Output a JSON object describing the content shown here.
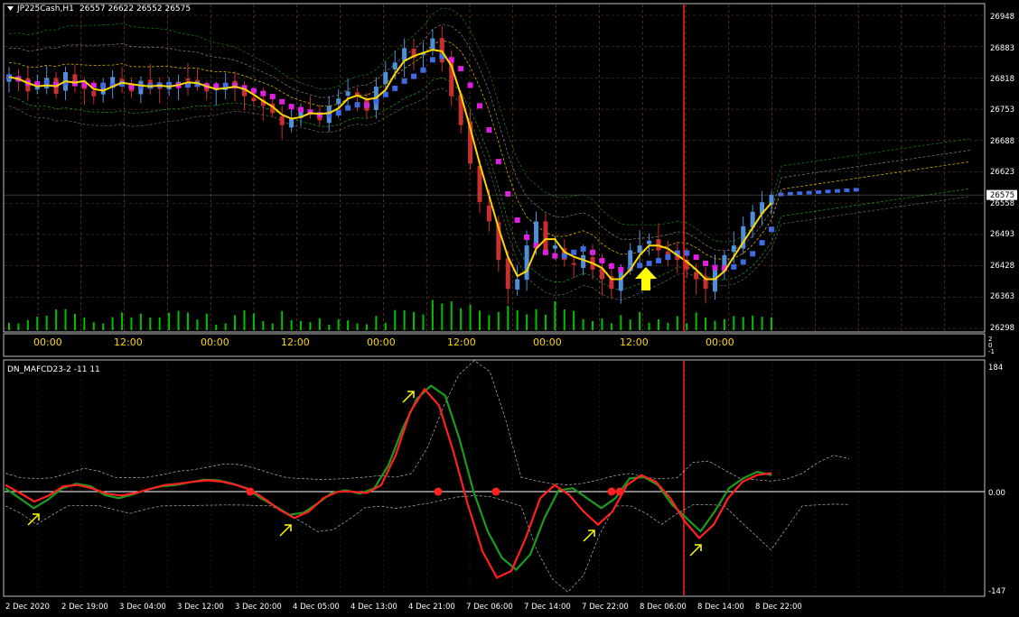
{
  "colors": {
    "background": "#000000",
    "frame": "#c0c0c0",
    "grid": "#c87a30",
    "bull_candle": "#4f8fd8",
    "bear_candle": "#c83030",
    "volume": "#00c000",
    "ma_fast": "#ffd700",
    "ma_bull": "#4169e1",
    "ma_bear": "#e020e0",
    "vline": "#ff2020",
    "arrow": "#ffff00",
    "osc_green": "#1e9a1e",
    "osc_red": "#ff2020",
    "osc_zero": "#ffffff",
    "text": "#ffffff"
  },
  "header": {
    "symbol_title": "JP225Cash,H1",
    "ohlc": "26557 26622 26552 26575",
    "menu_icon": "triangle-down-icon"
  },
  "price_scale": {
    "labels": [
      "26948",
      "26883",
      "26818",
      "26753",
      "26688",
      "26623",
      "26558",
      "26493",
      "26428",
      "26363",
      "26298"
    ],
    "current_price": "26575"
  },
  "time_strip": {
    "labels": [
      "00:00",
      "12:00",
      "00:00",
      "12:00",
      "00:00",
      "12:00",
      "00:00",
      "12:00",
      "00:00"
    ],
    "scale_labels": [
      "2",
      "0",
      "-1"
    ]
  },
  "oscillator": {
    "title": "DN_MAFCD23-2 -11 11",
    "scale_top": "184",
    "scale_zero": "0.00",
    "scale_bottom": "-147"
  },
  "bottom_axis": {
    "labels": [
      "2 Dec 2020",
      "2 Dec 19:00",
      "3 Dec 04:00",
      "3 Dec 12:00",
      "3 Dec 20:00",
      "4 Dec 05:00",
      "4 Dec 13:00",
      "4 Dec 21:00",
      "7 Dec 06:00",
      "7 Dec 14:00",
      "7 Dec 22:00",
      "8 Dec 06:00",
      "8 Dec 14:00",
      "8 Dec 22:00"
    ]
  },
  "chart_data": [
    {
      "type": "candlestick",
      "title": "JP225Cash,H1",
      "ylim": [
        26298,
        26960
      ],
      "price_ticks": [
        26948,
        26883,
        26818,
        26753,
        26688,
        26623,
        26558,
        26493,
        26428,
        26363,
        26298
      ],
      "current_price": 26575,
      "last_bar": {
        "open": 26557,
        "high": 26622,
        "low": 26552,
        "close": 26575
      },
      "close_path": [
        26820,
        26812,
        26790,
        26800,
        26818,
        26785,
        26830,
        26810,
        26795,
        26780,
        26800,
        26820,
        26805,
        26790,
        26812,
        26800,
        26795,
        26805,
        26810,
        26812,
        26800,
        26790,
        26795,
        26805,
        26800,
        26780,
        26770,
        26760,
        26745,
        26720,
        26735,
        26755,
        26745,
        26730,
        26760,
        26775,
        26790,
        26780,
        26750,
        26800,
        26830,
        26850,
        26880,
        26860,
        26870,
        26900,
        26850,
        26780,
        26720,
        26640,
        26560,
        26520,
        26440,
        26380,
        26400,
        26470,
        26520,
        26460,
        26470,
        26440,
        26430,
        26450,
        26420,
        26400,
        26380,
        26420,
        26460,
        26470,
        26480,
        26460,
        26450,
        26440,
        26420,
        26400,
        26380,
        26420,
        26450,
        26470,
        26510,
        26540,
        26560,
        26575
      ]
    },
    {
      "type": "line",
      "title": "DN_MAFCD23-2 -11 11",
      "ylim": [
        -147,
        184
      ],
      "zero_line": 0,
      "series": [
        {
          "values": [
            5,
            -10,
            -25,
            -12,
            5,
            12,
            8,
            -5,
            -10,
            -4,
            3,
            8,
            10,
            14,
            18,
            17,
            12,
            5,
            -10,
            -22,
            -35,
            -32,
            -18,
            -2,
            2,
            -3,
            5,
            40,
            95,
            140,
            160,
            145,
            80,
            0,
            -60,
            -100,
            -118,
            -95,
            -40,
            2,
            5,
            -10,
            -25,
            -10,
            20,
            22,
            10,
            -20,
            -40,
            -60,
            -30,
            5,
            20,
            30,
            25
          ]
        },
        {
          "values": [
            10,
            -2,
            -15,
            -6,
            8,
            10,
            5,
            -3,
            -6,
            -2,
            4,
            10,
            12,
            15,
            17,
            15,
            10,
            2,
            -12,
            -28,
            -40,
            -30,
            -10,
            0,
            0,
            -2,
            10,
            55,
            120,
            155,
            130,
            60,
            -20,
            -90,
            -130,
            -120,
            -70,
            -10,
            10,
            -5,
            -30,
            -50,
            -30,
            10,
            25,
            15,
            -10,
            -45,
            -70,
            -50,
            -10,
            15,
            25,
            28
          ]
        }
      ]
    }
  ]
}
